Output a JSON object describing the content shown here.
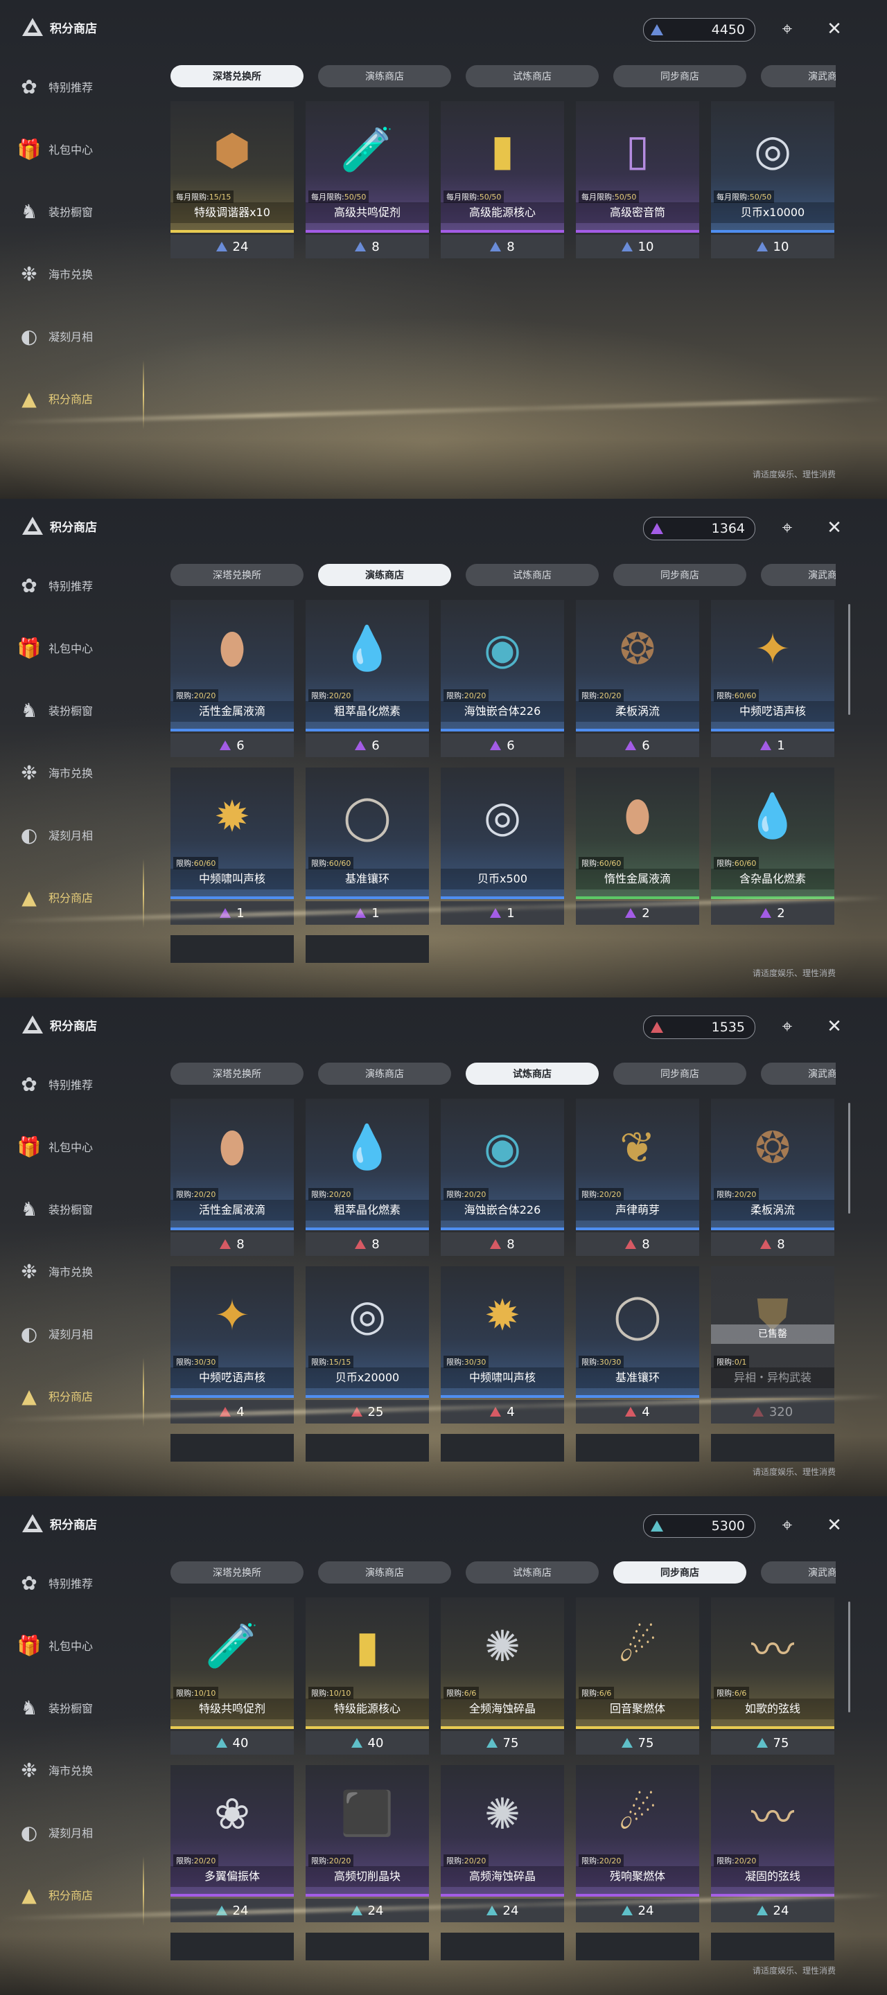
{
  "app": {
    "title": "积分商店",
    "notice": "请适度娱乐、理性消费"
  },
  "sidebar": [
    "特别推荐",
    "礼包中心",
    "装扮橱窗",
    "海市兑换",
    "凝刻月相",
    "积分商店"
  ],
  "tabs": [
    "深塔兑换所",
    "演练商店",
    "试炼商店",
    "同步商店",
    "演武商店"
  ],
  "colors": {
    "gold": "#e8cb52",
    "purple": "#a35ce6",
    "blue": "#4f8ef0",
    "green": "#5cc766",
    "active_side": "#e6cd7a"
  },
  "panels": [
    {
      "currency": "4450",
      "currency_color": "#6a8cd8",
      "active_tab": 0,
      "items": [
        {
          "name": "特级调谐器x10",
          "limit_label": "每月限购:",
          "limit": "15/15",
          "price": "24",
          "rarity": "gold",
          "icon": "tuner-icon"
        },
        {
          "name": "高级共鸣促剂",
          "limit_label": "每月限购:",
          "limit": "50/50",
          "price": "8",
          "rarity": "purple",
          "icon": "vial-icon"
        },
        {
          "name": "高级能源核心",
          "limit_label": "每月限购:",
          "limit": "50/50",
          "price": "8",
          "rarity": "purple",
          "icon": "energy-core-icon"
        },
        {
          "name": "高级密音筒",
          "limit_label": "每月限购:",
          "limit": "50/50",
          "price": "10",
          "rarity": "purple",
          "icon": "sound-tube-icon"
        },
        {
          "name": "贝币x10000",
          "limit_label": "每月限购:",
          "limit": "50/50",
          "price": "10",
          "rarity": "blue",
          "icon": "shell-coin-icon"
        }
      ]
    },
    {
      "currency": "1364",
      "currency_color": "#a35ce6",
      "active_tab": 1,
      "items": [
        {
          "name": "活性金属液滴",
          "limit_label": "限购:",
          "limit": "20/20",
          "price": "6",
          "rarity": "blue",
          "icon": "metal-drop-icon"
        },
        {
          "name": "粗萃晶化燃素",
          "limit_label": "限购:",
          "limit": "20/20",
          "price": "6",
          "rarity": "blue",
          "icon": "crystal-drop-icon"
        },
        {
          "name": "海蚀嵌合体226",
          "limit_label": "限购:",
          "limit": "20/20",
          "price": "6",
          "rarity": "blue",
          "icon": "orb-icon"
        },
        {
          "name": "柔板涡流",
          "limit_label": "限购:",
          "limit": "20/20",
          "price": "6",
          "rarity": "blue",
          "icon": "spiral-icon"
        },
        {
          "name": "中频呓语声核",
          "limit_label": "限购:",
          "limit": "60/60",
          "price": "1",
          "rarity": "blue",
          "icon": "star-icon"
        },
        {
          "name": "中频啸叫声核",
          "limit_label": "限购:",
          "limit": "60/60",
          "price": "1",
          "rarity": "blue",
          "icon": "core-icon"
        },
        {
          "name": "基准镶环",
          "limit_label": "限购:",
          "limit": "60/60",
          "price": "1",
          "rarity": "blue",
          "icon": "ring-icon"
        },
        {
          "name": "贝币x500",
          "limit_label": "",
          "limit": "",
          "price": "1",
          "rarity": "blue",
          "icon": "shell-coin-icon"
        },
        {
          "name": "惰性金属液滴",
          "limit_label": "限购:",
          "limit": "60/60",
          "price": "2",
          "rarity": "green",
          "icon": "metal-drop-icon"
        },
        {
          "name": "含杂晶化燃素",
          "limit_label": "限购:",
          "limit": "60/60",
          "price": "2",
          "rarity": "green",
          "icon": "crystal-drop-icon"
        }
      ],
      "stubs": 2
    },
    {
      "currency": "1535",
      "currency_color": "#d75a64",
      "active_tab": 2,
      "items": [
        {
          "name": "活性金属液滴",
          "limit_label": "限购:",
          "limit": "20/20",
          "price": "8",
          "rarity": "blue",
          "icon": "metal-drop-icon"
        },
        {
          "name": "粗萃晶化燃素",
          "limit_label": "限购:",
          "limit": "20/20",
          "price": "8",
          "rarity": "blue",
          "icon": "crystal-drop-icon"
        },
        {
          "name": "海蚀嵌合体226",
          "limit_label": "限购:",
          "limit": "20/20",
          "price": "8",
          "rarity": "blue",
          "icon": "orb-icon"
        },
        {
          "name": "声律萌芽",
          "limit_label": "限购:",
          "limit": "20/20",
          "price": "8",
          "rarity": "blue",
          "icon": "sprout-icon"
        },
        {
          "name": "柔板涡流",
          "limit_label": "限购:",
          "limit": "20/20",
          "price": "8",
          "rarity": "blue",
          "icon": "spiral-icon"
        },
        {
          "name": "中频呓语声核",
          "limit_label": "限购:",
          "limit": "30/30",
          "price": "4",
          "rarity": "blue",
          "icon": "star-icon"
        },
        {
          "name": "贝币x20000",
          "limit_label": "限购:",
          "limit": "15/15",
          "price": "25",
          "rarity": "blue",
          "icon": "shell-coin-icon"
        },
        {
          "name": "中频啸叫声核",
          "limit_label": "限购:",
          "limit": "30/30",
          "price": "4",
          "rarity": "blue",
          "icon": "core-icon"
        },
        {
          "name": "基准镶环",
          "limit_label": "限购:",
          "limit": "30/30",
          "price": "4",
          "rarity": "blue",
          "icon": "ring-icon"
        },
        {
          "name": "异相・异构武装",
          "limit_label": "限购:",
          "limit": "0/1",
          "price": "320",
          "rarity": "grey",
          "icon": "armor-icon",
          "sold_label": "已售罄"
        }
      ],
      "stubs": 5
    },
    {
      "currency": "5300",
      "currency_color": "#5fc0c9",
      "active_tab": 3,
      "items": [
        {
          "name": "特级共鸣促剂",
          "limit_label": "限购:",
          "limit": "10/10",
          "price": "40",
          "rarity": "gold",
          "icon": "vial-icon"
        },
        {
          "name": "特级能源核心",
          "limit_label": "限购:",
          "limit": "10/10",
          "price": "40",
          "rarity": "gold",
          "icon": "energy-core-icon"
        },
        {
          "name": "全频海蚀碎晶",
          "limit_label": "限购:",
          "limit": "6/6",
          "price": "75",
          "rarity": "gold",
          "icon": "shard-disc-icon"
        },
        {
          "name": "回音聚燃体",
          "limit_label": "限购:",
          "limit": "6/6",
          "price": "75",
          "rarity": "gold",
          "icon": "flame-crystal-icon"
        },
        {
          "name": "如歌的弦线",
          "limit_label": "限购:",
          "limit": "6/6",
          "price": "75",
          "rarity": "gold",
          "icon": "string-icon"
        },
        {
          "name": "多翼偏振体",
          "limit_label": "限购:",
          "limit": "20/20",
          "price": "24",
          "rarity": "purple",
          "icon": "butterfly-icon"
        },
        {
          "name": "高频切削晶块",
          "limit_label": "限购:",
          "limit": "20/20",
          "price": "24",
          "rarity": "purple",
          "icon": "cube-icon"
        },
        {
          "name": "高频海蚀碎晶",
          "limit_label": "限购:",
          "limit": "20/20",
          "price": "24",
          "rarity": "purple",
          "icon": "shard-disc-icon"
        },
        {
          "name": "残响聚燃体",
          "limit_label": "限购:",
          "limit": "20/20",
          "price": "24",
          "rarity": "purple",
          "icon": "flame-crystal-icon"
        },
        {
          "name": "凝固的弦线",
          "limit_label": "限购:",
          "limit": "20/20",
          "price": "24",
          "rarity": "purple",
          "icon": "string-icon"
        }
      ],
      "stubs": 5
    }
  ]
}
